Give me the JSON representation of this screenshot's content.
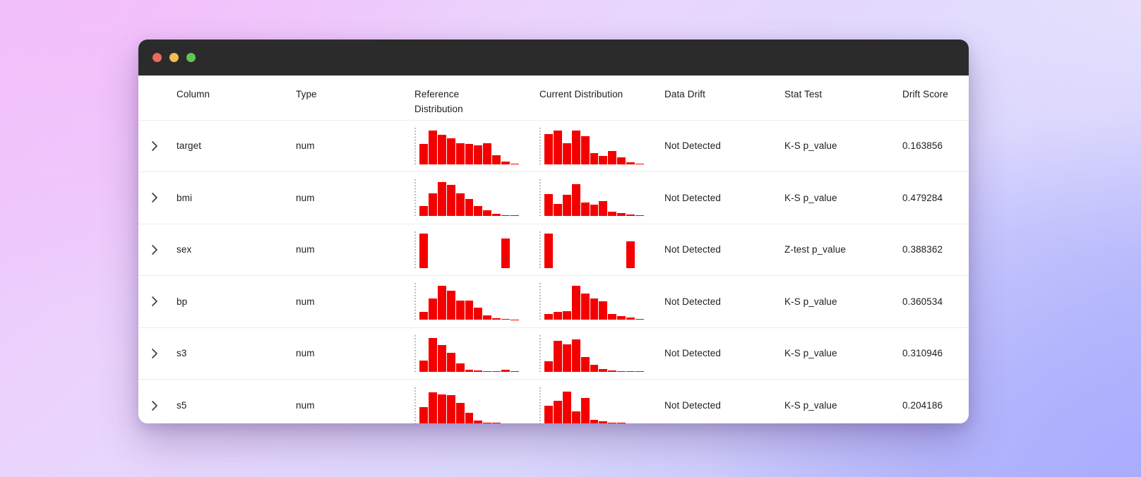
{
  "window": {
    "traffic_lights": [
      {
        "name": "close",
        "color": "#ed6a5e"
      },
      {
        "name": "minimize",
        "color": "#f5bd4f"
      },
      {
        "name": "maximize",
        "color": "#61c554"
      }
    ]
  },
  "table": {
    "headers": [
      {
        "key": "expand",
        "label": ""
      },
      {
        "key": "column",
        "label": "Column"
      },
      {
        "key": "type",
        "label": "Type"
      },
      {
        "key": "reference_distribution",
        "label": "Reference\nDistribution"
      },
      {
        "key": "current_distribution",
        "label": "Current Distribution"
      },
      {
        "key": "data_drift",
        "label": "Data Drift"
      },
      {
        "key": "stat_test",
        "label": "Stat Test"
      },
      {
        "key": "drift_score",
        "label": "Drift Score"
      }
    ],
    "header_labels": {
      "column": "Column",
      "type": "Type",
      "reference_line1": "Reference",
      "reference_line2": "Distribution",
      "current": "Current Distribution",
      "data_drift": "Data Drift",
      "stat_test": "Stat Test",
      "drift_score": "Drift Score"
    },
    "rows": [
      {
        "column": "target",
        "type": "num",
        "data_drift": "Not Detected",
        "stat_test": "K-S p_value",
        "drift_score": "0.163856",
        "expand_icon": "chevron-right-icon"
      },
      {
        "column": "bmi",
        "type": "num",
        "data_drift": "Not Detected",
        "stat_test": "K-S p_value",
        "drift_score": "0.479284",
        "expand_icon": "chevron-right-icon"
      },
      {
        "column": "sex",
        "type": "num",
        "data_drift": "Not Detected",
        "stat_test": "Z-test p_value",
        "drift_score": "0.388362",
        "expand_icon": "chevron-right-icon"
      },
      {
        "column": "bp",
        "type": "num",
        "data_drift": "Not Detected",
        "stat_test": "K-S p_value",
        "drift_score": "0.360534",
        "expand_icon": "chevron-right-icon"
      },
      {
        "column": "s3",
        "type": "num",
        "data_drift": "Not Detected",
        "stat_test": "K-S p_value",
        "drift_score": "0.310946",
        "expand_icon": "chevron-right-icon"
      },
      {
        "column": "s5",
        "type": "num",
        "data_drift": "Not Detected",
        "stat_test": "K-S p_value",
        "drift_score": "0.204186",
        "expand_icon": "chevron-right-icon"
      }
    ]
  },
  "colors": {
    "bar": "#f40000",
    "axis_dots": "#b8b8b8",
    "row_divider": "#ececec",
    "titlebar": "#2b2b2b",
    "text": "#1e1e1e",
    "surface": "#ffffff"
  },
  "chart_data": [
    {
      "type": "bar",
      "title": "target - Reference Distribution",
      "row": "target",
      "which": "reference",
      "xlabel": "",
      "ylabel": "",
      "ylim": [
        0,
        100
      ],
      "categories": [
        "1",
        "2",
        "3",
        "4",
        "5",
        "6",
        "7",
        "8",
        "9",
        "10",
        "11"
      ],
      "values": [
        56,
        92,
        80,
        70,
        57,
        56,
        52,
        57,
        24,
        7,
        2
      ]
    },
    {
      "type": "bar",
      "title": "target - Current Distribution",
      "row": "target",
      "which": "current",
      "xlabel": "",
      "ylabel": "",
      "ylim": [
        0,
        100
      ],
      "categories": [
        "1",
        "2",
        "3",
        "4",
        "5",
        "6",
        "7",
        "8",
        "9",
        "10",
        "11"
      ],
      "values": [
        82,
        92,
        58,
        92,
        76,
        30,
        22,
        36,
        18,
        6,
        2
      ]
    },
    {
      "type": "bar",
      "title": "bmi - Reference Distribution",
      "row": "bmi",
      "which": "reference",
      "xlabel": "",
      "ylabel": "",
      "ylim": [
        0,
        100
      ],
      "categories": [
        "1",
        "2",
        "3",
        "4",
        "5",
        "6",
        "7",
        "8",
        "9",
        "10",
        "11"
      ],
      "values": [
        28,
        62,
        92,
        86,
        62,
        46,
        28,
        16,
        6,
        3,
        2
      ]
    },
    {
      "type": "bar",
      "title": "bmi - Current Distribution",
      "row": "bmi",
      "which": "current",
      "xlabel": "",
      "ylabel": "",
      "ylim": [
        0,
        100
      ],
      "categories": [
        "1",
        "2",
        "3",
        "4",
        "5",
        "6",
        "7",
        "8",
        "9",
        "10",
        "11"
      ],
      "values": [
        60,
        34,
        58,
        88,
        38,
        32,
        40,
        12,
        8,
        5,
        3
      ]
    },
    {
      "type": "bar",
      "title": "sex - Reference Distribution",
      "row": "sex",
      "which": "reference",
      "xlabel": "",
      "ylabel": "",
      "ylim": [
        0,
        100
      ],
      "categories": [
        "1",
        "2",
        "3",
        "4",
        "5",
        "6",
        "7",
        "8",
        "9",
        "10",
        "11"
      ],
      "values": [
        94,
        0,
        0,
        0,
        0,
        0,
        0,
        0,
        0,
        80,
        0
      ]
    },
    {
      "type": "bar",
      "title": "sex - Current Distribution",
      "row": "sex",
      "which": "current",
      "xlabel": "",
      "ylabel": "",
      "ylim": [
        0,
        100
      ],
      "categories": [
        "1",
        "2",
        "3",
        "4",
        "5",
        "6",
        "7",
        "8",
        "9",
        "10",
        "11"
      ],
      "values": [
        94,
        0,
        0,
        0,
        0,
        0,
        0,
        0,
        0,
        72,
        0
      ]
    },
    {
      "type": "bar",
      "title": "bp - Reference Distribution",
      "row": "bp",
      "which": "reference",
      "xlabel": "",
      "ylabel": "",
      "ylim": [
        0,
        100
      ],
      "categories": [
        "1",
        "2",
        "3",
        "4",
        "5",
        "6",
        "7",
        "8",
        "9",
        "10",
        "11"
      ],
      "values": [
        22,
        58,
        92,
        80,
        52,
        52,
        34,
        12,
        4,
        2,
        1
      ]
    },
    {
      "type": "bar",
      "title": "bp - Current Distribution",
      "row": "bp",
      "which": "current",
      "xlabel": "",
      "ylabel": "",
      "ylim": [
        0,
        100
      ],
      "categories": [
        "1",
        "2",
        "3",
        "4",
        "5",
        "6",
        "7",
        "8",
        "9",
        "10",
        "11"
      ],
      "values": [
        16,
        22,
        24,
        92,
        72,
        58,
        50,
        16,
        10,
        6,
        2
      ]
    },
    {
      "type": "bar",
      "title": "s3 - Reference Distribution",
      "row": "s3",
      "which": "reference",
      "xlabel": "",
      "ylabel": "",
      "ylim": [
        0,
        100
      ],
      "categories": [
        "1",
        "2",
        "3",
        "4",
        "5",
        "6",
        "7",
        "8",
        "9",
        "10",
        "11"
      ],
      "values": [
        30,
        92,
        72,
        52,
        22,
        6,
        3,
        2,
        1,
        6,
        2
      ]
    },
    {
      "type": "bar",
      "title": "s3 - Current Distribution",
      "row": "s3",
      "which": "current",
      "xlabel": "",
      "ylabel": "",
      "ylim": [
        0,
        100
      ],
      "categories": [
        "1",
        "2",
        "3",
        "4",
        "5",
        "6",
        "7",
        "8",
        "9",
        "10",
        "11"
      ],
      "values": [
        28,
        84,
        74,
        88,
        40,
        18,
        8,
        4,
        2,
        1,
        1
      ]
    },
    {
      "type": "bar",
      "title": "s5 - Reference Distribution",
      "row": "s5",
      "which": "reference",
      "xlabel": "",
      "ylabel": "",
      "ylim": [
        0,
        100
      ],
      "categories": [
        "1",
        "2",
        "3",
        "4",
        "5",
        "6",
        "7",
        "8",
        "9",
        "10",
        "11"
      ],
      "values": [
        46,
        86,
        80,
        78,
        56,
        30,
        8,
        3,
        2,
        1,
        1
      ]
    },
    {
      "type": "bar",
      "title": "s5 - Current Distribution",
      "row": "s5",
      "which": "current",
      "xlabel": "",
      "ylabel": "",
      "ylim": [
        0,
        100
      ],
      "categories": [
        "1",
        "2",
        "3",
        "4",
        "5",
        "6",
        "7",
        "8",
        "9",
        "10",
        "11"
      ],
      "values": [
        50,
        62,
        88,
        34,
        70,
        10,
        6,
        3,
        2,
        1,
        1
      ]
    }
  ]
}
